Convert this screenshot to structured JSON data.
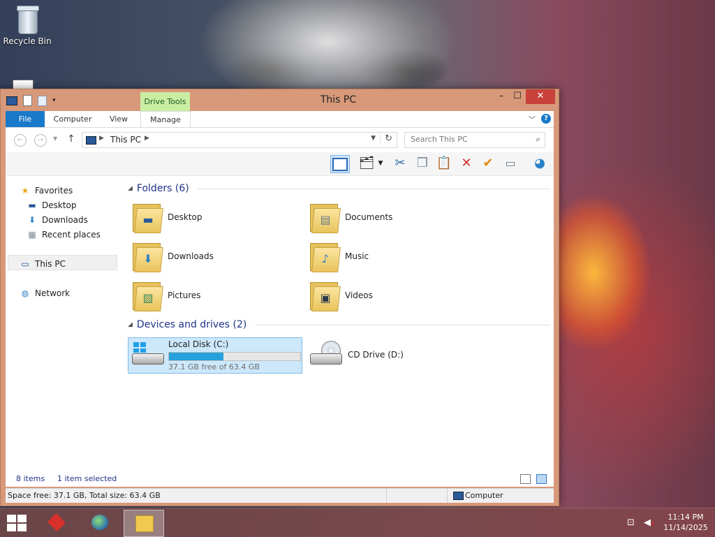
{
  "desktop": {
    "recycle_bin_label": "Recycle Bin"
  },
  "window": {
    "title": "This PC",
    "contextual_tab": "Drive Tools",
    "controls": {
      "minimize": "–",
      "maximize": "☐",
      "close": "✕"
    }
  },
  "ribbon": {
    "tabs": [
      "File",
      "Computer",
      "View",
      "Manage"
    ],
    "help": "?"
  },
  "address": {
    "path": "This PC",
    "search_placeholder": "Search This PC"
  },
  "toolbar": {
    "icons": [
      "preview-pane-icon",
      "select-all-icon",
      "cut-icon",
      "copy-icon",
      "paste-icon",
      "delete-icon",
      "rename-icon",
      "properties-icon",
      "options-icon"
    ]
  },
  "nav": {
    "favorites": "Favorites",
    "desktop": "Desktop",
    "downloads": "Downloads",
    "recent": "Recent places",
    "this_pc": "This PC",
    "network": "Network"
  },
  "folders_header": "Folders (6)",
  "folders": [
    {
      "name": "Desktop",
      "icon": "desktop-folder-icon"
    },
    {
      "name": "Documents",
      "icon": "documents-folder-icon"
    },
    {
      "name": "Downloads",
      "icon": "downloads-folder-icon"
    },
    {
      "name": "Music",
      "icon": "music-folder-icon"
    },
    {
      "name": "Pictures",
      "icon": "pictures-folder-icon"
    },
    {
      "name": "Videos",
      "icon": "videos-folder-icon"
    }
  ],
  "devices_header": "Devices and drives (2)",
  "drives": [
    {
      "name": "Local Disk (C:)",
      "free": "37.1 GB free of 63.4 GB",
      "used_fraction": 0.415,
      "selected": true
    },
    {
      "name": "CD Drive (D:)"
    }
  ],
  "status": {
    "items": "8 items",
    "selected": "1 item selected"
  },
  "details": {
    "space": "Space free: 37.1 GB, Total size: 63.4 GB",
    "location": "Computer"
  },
  "taskbar": {
    "time": "11:14 PM",
    "date": "11/14/2025"
  },
  "colors": {
    "accent": "#1979ca",
    "window_frame": "#d7997a",
    "close": "#c8413b",
    "progress": "#26a0da"
  }
}
